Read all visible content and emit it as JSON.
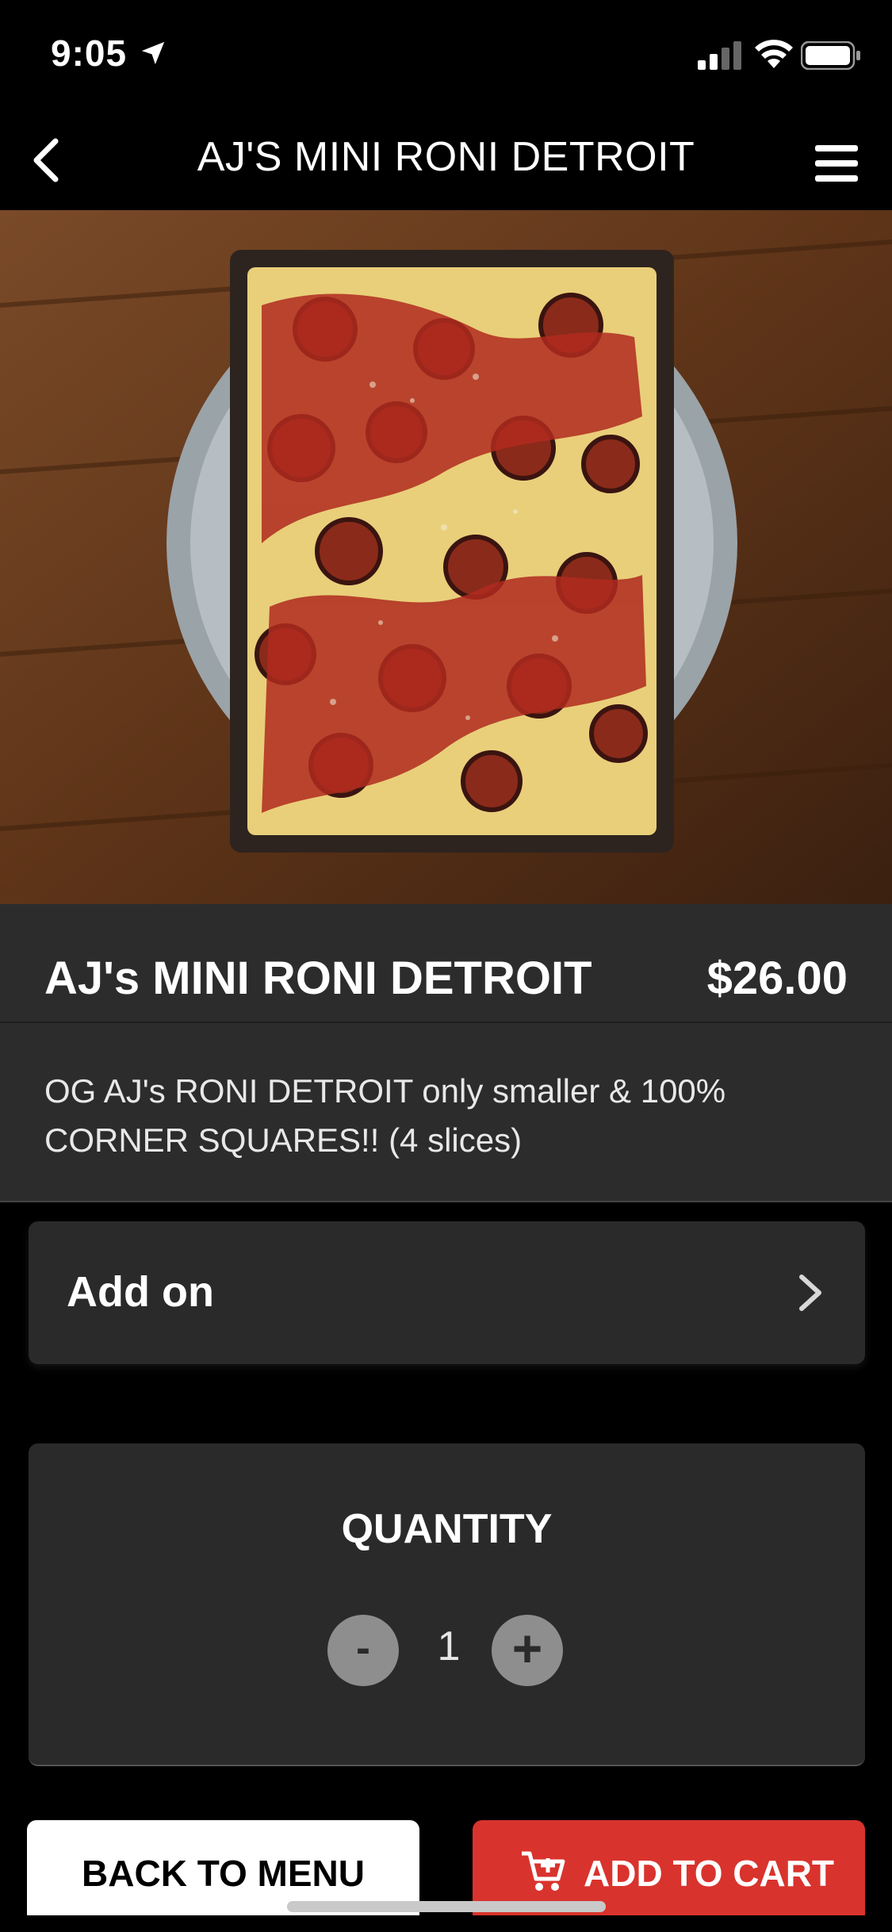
{
  "status_bar": {
    "time": "9:05"
  },
  "header": {
    "title": "AJ'S MINI RONI DETROIT"
  },
  "item": {
    "name": "AJ's MINI RONI DETROIT",
    "price": "$26.00",
    "description": "OG AJ's RONI DETROIT only smaller & 100% CORNER SQUARES!! (4 slices)"
  },
  "addon": {
    "label": "Add on"
  },
  "quantity": {
    "title": "QUANTITY",
    "value": "1",
    "minus_label": "-",
    "plus_label": "+"
  },
  "buttons": {
    "back_to_menu": "BACK TO MENU",
    "add_to_cart": "ADD TO CART"
  },
  "colors": {
    "background": "#000000",
    "card": "#2c2c2c",
    "accent_red": "#d9332d",
    "qty_button": "#8e8e8e"
  },
  "icons": [
    "location-arrow-icon",
    "signal-icon",
    "wifi-icon",
    "battery-icon",
    "back-chevron-icon",
    "hamburger-menu-icon",
    "chevron-right-icon",
    "minus-icon",
    "plus-icon",
    "cart-plus-icon"
  ]
}
